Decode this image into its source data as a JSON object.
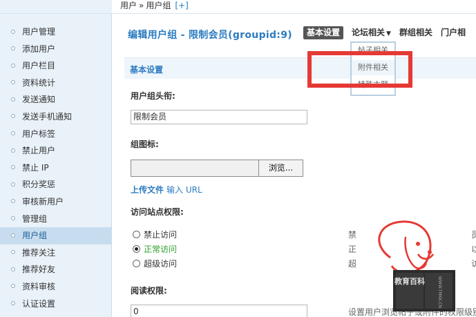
{
  "breadcrumb": {
    "part1": "用户",
    "sep": "»",
    "part2": "用户组",
    "add": "[+]"
  },
  "sidebar": {
    "items": [
      {
        "label": "用户管理"
      },
      {
        "label": "添加用户"
      },
      {
        "label": "用户栏目"
      },
      {
        "label": "资料统计"
      },
      {
        "label": "发送通知"
      },
      {
        "label": "发送手机通知"
      },
      {
        "label": "用户标签"
      },
      {
        "label": "禁止用户"
      },
      {
        "label": "禁止 IP"
      },
      {
        "label": "积分奖惩"
      },
      {
        "label": "审核新用户"
      },
      {
        "label": "管理组"
      },
      {
        "label": "用户组",
        "active": true
      },
      {
        "label": "推荐关注"
      },
      {
        "label": "推荐好友"
      },
      {
        "label": "资料审核"
      },
      {
        "label": "认证设置"
      }
    ]
  },
  "main": {
    "title": "编辑用户组 - 限制会员(groupid:9)",
    "tabs": {
      "basic": "基本设置",
      "forum": "论坛相关",
      "group": "群组相关",
      "portal": "门户相"
    },
    "dropdown": {
      "items": [
        "帖子相关",
        "附件相关",
        "特殊主题"
      ]
    },
    "section_title": "基本设置",
    "group_title_label": "用户组头衔:",
    "group_title_value": "限制会员",
    "group_icon_label": "组图标:",
    "browse_button": "浏览...",
    "upload_file": "上传文件",
    "input_url": "输入 URL",
    "access_label": "访问站点权限:",
    "access_options": [
      "禁止访问",
      "正常访问",
      "超级访问"
    ],
    "access_selected": "正常访问",
    "access_right_col": [
      "禁",
      "正",
      "超"
    ],
    "far_right_col": [
      "员",
      "以",
      "访"
    ],
    "read_label": "阅读权限:",
    "read_value": "0",
    "bottom_note": "设置用户浏览帖子或附件的权限级别"
  },
  "watermark": {
    "text": "教育百科",
    "url": "WWW.TMKK.CN"
  },
  "colors": {
    "sidebar_bg": "#e9f2f9",
    "active_item_bg": "#c7ddef",
    "accent": "#2d7cc1",
    "highlight_red": "#e53935",
    "selected_green": "#2aa02a"
  }
}
